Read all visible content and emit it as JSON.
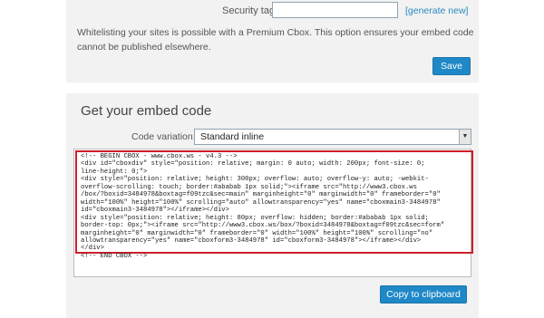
{
  "security": {
    "label": "Security tag:",
    "value": "",
    "generate_link": "[generate new]"
  },
  "info_text": "Whitelisting your sites is possible with a Premium Cbox. This option ensures your embed code cannot be published elsewhere.",
  "save_button": "Save",
  "embed": {
    "title": "Get your embed code",
    "variation_label": "Code variation:",
    "variation_value": "Standard inline",
    "code": "<!-- BEGIN CBOX - www.cbox.ws - v4.3 -->\n<div id=\"cboxdiv\" style=\"position: relative; margin: 0 auto; width: 200px; font-size: 0;\nline-height: 0;\">\n<div style=\"position: relative; height: 300px; overflow: auto; overflow-y: auto; -webkit-\noverflow-scrolling: touch; border:#ababab 1px solid;\"><iframe src=\"http://www3.cbox.ws\n/box/?boxid=3484978&boxtag=f09tzc&sec=main\" marginheight=\"0\" marginwidth=\"0\" frameborder=\"0\"\nwidth=\"100%\" height=\"100%\" scrolling=\"auto\" allowtransparency=\"yes\" name=\"cboxmain3-3484978\"\nid=\"cboxmain3-3484978\"></iframe></div>\n<div style=\"position: relative; height: 80px; overflow: hidden; border:#ababab 1px solid;\nborder-top: 0px;\"><iframe src=\"http://www3.cbox.ws/box/?boxid=3484978&boxtag=f09tzc&sec=form\"\nmarginheight=\"0\" marginwidth=\"0\" frameborder=\"0\" width=\"100%\" height=\"100%\" scrolling=\"no\"\nallowtransparency=\"yes\" name=\"cboxform3-3484978\" id=\"cboxform3-3484978\"></iframe></div>\n</div>\n<!-- END CBOX -->",
    "copy_button": "Copy to clipboard"
  },
  "colors": {
    "panel_bg": "#f2f2f2",
    "button_blue": "#1f88c7",
    "link_blue": "#2a8ac0",
    "highlight_red": "#cc1f2b"
  },
  "icons": {
    "select_arrow": "chevron-down-icon"
  }
}
